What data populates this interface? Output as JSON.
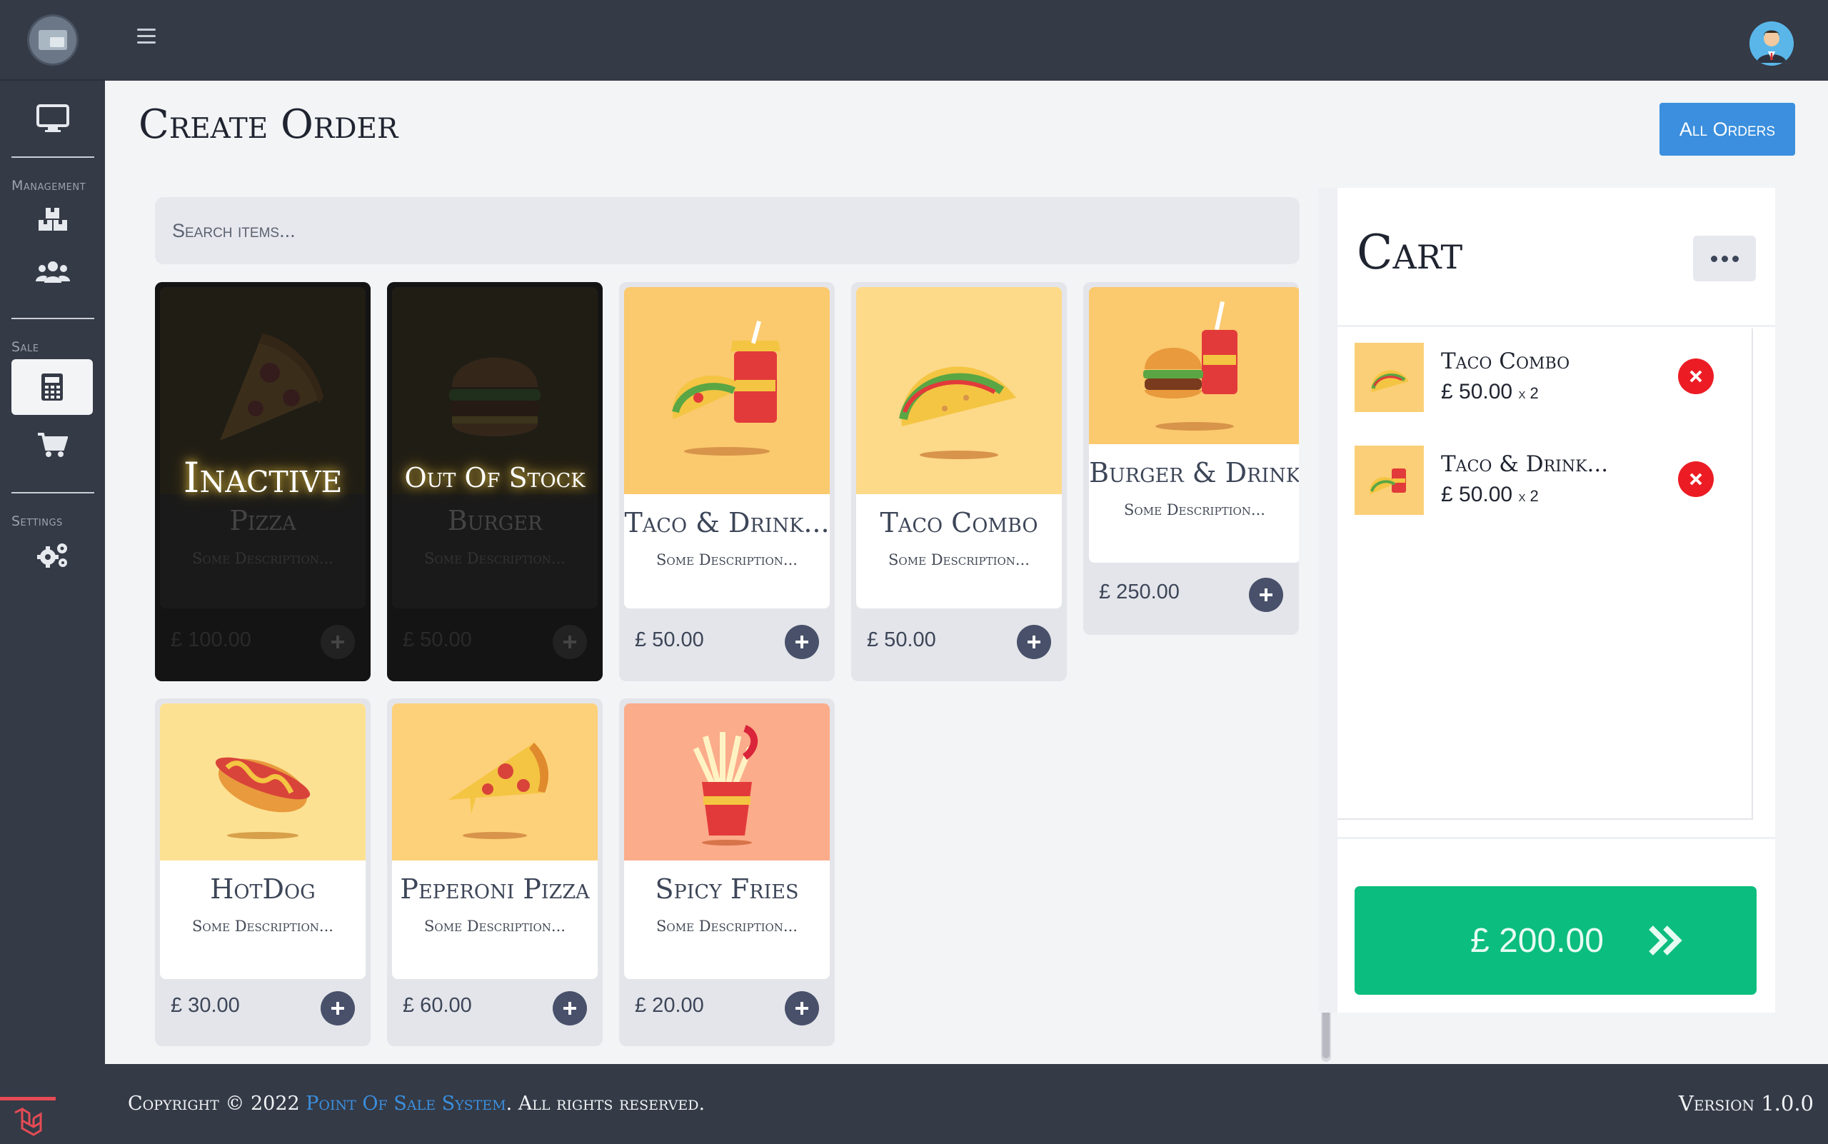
{
  "header": {
    "title": "Create Order",
    "all_orders_label": "All Orders"
  },
  "sidebar": {
    "sections": [
      {
        "label": "Management"
      },
      {
        "label": "Sale"
      },
      {
        "label": "Settings"
      }
    ]
  },
  "search": {
    "placeholder": "Search items..."
  },
  "items": [
    {
      "name": "Pizza",
      "desc": "Some Description...",
      "price": "£ 100.00",
      "status": "Inactive"
    },
    {
      "name": "Burger",
      "desc": "Some Description...",
      "price": "£ 50.00",
      "status": "Out Of Stock"
    },
    {
      "name": "Taco & Drink...",
      "desc": "Some Description...",
      "price": "£ 50.00"
    },
    {
      "name": "Taco Combo",
      "desc": "Some Description...",
      "price": "£ 50.00"
    },
    {
      "name": "Burger & Drink",
      "desc": "Some Description...",
      "price": "£ 250.00"
    },
    {
      "name": "HotDog",
      "desc": "Some Description...",
      "price": "£ 30.00"
    },
    {
      "name": "Peperoni Pizza",
      "desc": "Some Description...",
      "price": "£ 60.00"
    },
    {
      "name": "Spicy Fries",
      "desc": "Some Description...",
      "price": "£ 20.00"
    }
  ],
  "cart": {
    "title": "Cart",
    "items": [
      {
        "name": "Taco Combo",
        "price": "£ 50.00",
        "qty": "x 2"
      },
      {
        "name": "Taco & Drink...",
        "price": "£ 50.00",
        "qty": "x 2"
      }
    ],
    "total": "£ 200.00"
  },
  "footer": {
    "copyright_prefix": "Copyright © 2022",
    "brand": "Point Of Sale System",
    "copyright_suffix": ". All rights reserved.",
    "version": "Version 1.0.0"
  }
}
